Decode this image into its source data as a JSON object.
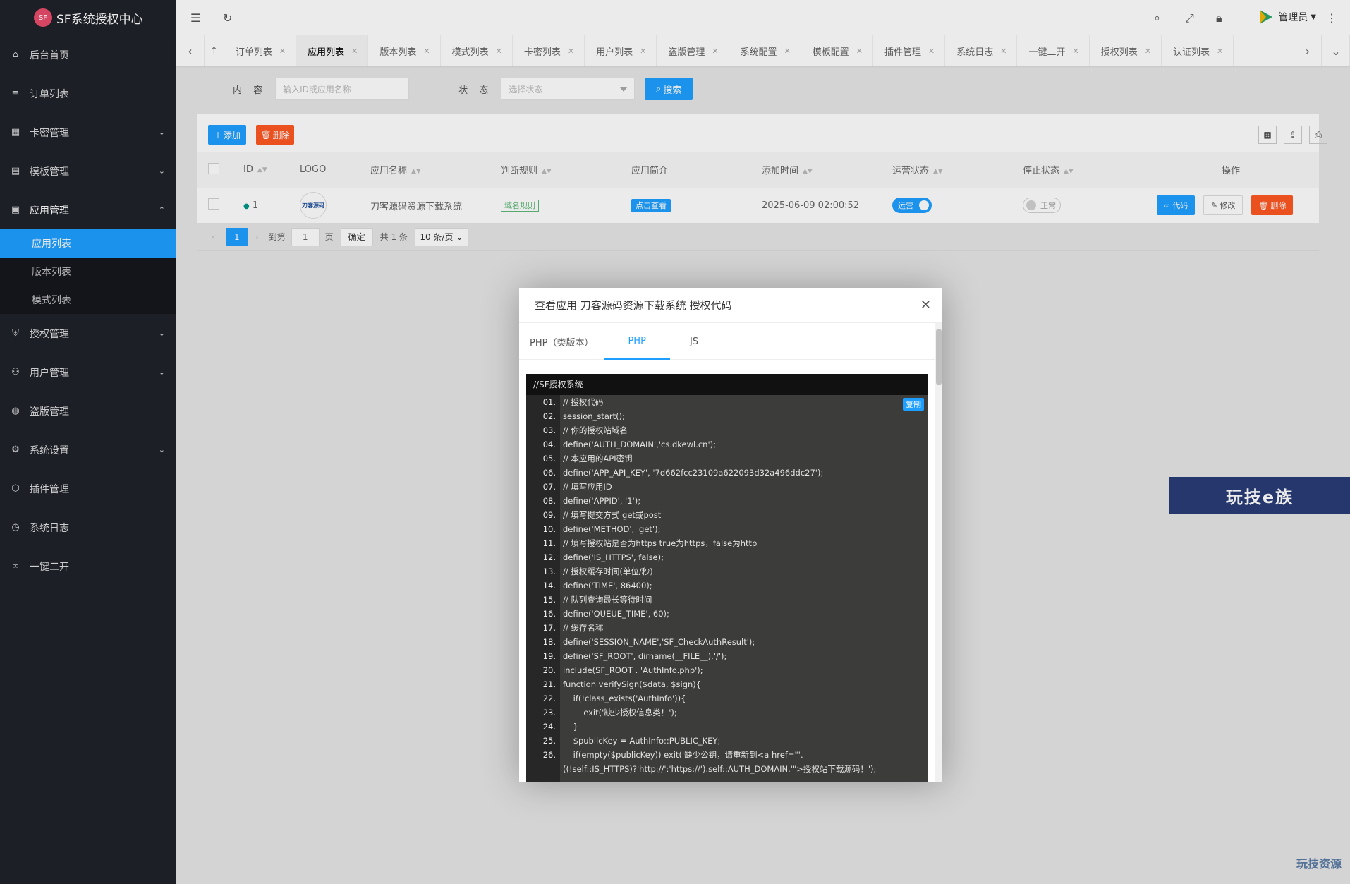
{
  "app": {
    "title": "SF系统授权中心",
    "logo_text": "SF"
  },
  "sidebar": {
    "items": [
      {
        "label": "后台首页",
        "icon": "home-icon"
      },
      {
        "label": "订单列表",
        "icon": "list-icon"
      },
      {
        "label": "卡密管理",
        "icon": "grid-icon"
      },
      {
        "label": "模板管理",
        "icon": "template-icon"
      },
      {
        "label": "应用管理",
        "icon": "apps-icon"
      },
      {
        "label": "授权管理",
        "icon": "shield-icon"
      },
      {
        "label": "用户管理",
        "icon": "user-icon"
      },
      {
        "label": "盗版管理",
        "icon": "globe-icon"
      },
      {
        "label": "系统设置",
        "icon": "gear-icon"
      },
      {
        "label": "插件管理",
        "icon": "plugin-icon"
      },
      {
        "label": "系统日志",
        "icon": "clock-icon"
      },
      {
        "label": "一键二开",
        "icon": "link-icon"
      }
    ],
    "sub_items": [
      "应用列表",
      "版本列表",
      "模式列表"
    ]
  },
  "header": {
    "user_label": "管理员"
  },
  "tabs": [
    "订单列表",
    "应用列表",
    "版本列表",
    "模式列表",
    "卡密列表",
    "用户列表",
    "盗版管理",
    "系统配置",
    "模板配置",
    "插件管理",
    "系统日志",
    "一键二开",
    "授权列表",
    "认证列表"
  ],
  "search": {
    "content_label": "内 容",
    "content_placeholder": "输入ID或应用名称",
    "status_label": "状 态",
    "status_placeholder": "选择状态",
    "search_button": "搜索"
  },
  "toolbar": {
    "add_label": "添加",
    "delete_label": "删除"
  },
  "table": {
    "headers": [
      "ID",
      "LOGO",
      "应用名称",
      "判断规则",
      "应用简介",
      "添加时间",
      "运营状态",
      "停止状态",
      "操作"
    ],
    "row": {
      "id": "1",
      "logo_text": "刀客源码",
      "name": "刀客源码资源下载系统",
      "rule": "域名规则",
      "intro": "点击查看",
      "added": "2025-06-09 02:00:52",
      "run_status": "运营",
      "stop_status": "正常",
      "code_btn": "代码",
      "edit_btn": "修改",
      "delete_btn": "删除"
    }
  },
  "pager": {
    "current": "1",
    "goto_label": "到第",
    "goto_value": "1",
    "page_label": "页",
    "confirm": "确定",
    "total": "共 1 条",
    "per_page": "10 条/页"
  },
  "dialog": {
    "title": "查看应用 刀客源码资源下载系统 授权代码",
    "tabs": [
      "PHP（类版本）",
      "PHP",
      "JS"
    ],
    "code_header": "//SF授权系统",
    "copy_label": "复制",
    "lines": [
      {
        "n": "01.",
        "t": "// 授权代码"
      },
      {
        "n": "02.",
        "t": "session_start();"
      },
      {
        "n": "03.",
        "t": "// 你的授权站域名"
      },
      {
        "n": "04.",
        "t": "define('AUTH_DOMAIN','cs.dkewl.cn');"
      },
      {
        "n": "05.",
        "t": "// 本应用的API密钥"
      },
      {
        "n": "06.",
        "t": "define('APP_API_KEY', '7d662fcc23109a622093d32a496ddc27');"
      },
      {
        "n": "07.",
        "t": "// 填写应用ID"
      },
      {
        "n": "08.",
        "t": "define('APPID', '1');"
      },
      {
        "n": "09.",
        "t": "// 填写提交方式 get或post"
      },
      {
        "n": "10.",
        "t": "define('METHOD', 'get');"
      },
      {
        "n": "11.",
        "t": "// 填写授权站是否为https true为https，false为http"
      },
      {
        "n": "12.",
        "t": "define('IS_HTTPS', false);"
      },
      {
        "n": "13.",
        "t": "// 授权缓存时间(单位/秒)"
      },
      {
        "n": "14.",
        "t": "define('TIME', 86400);"
      },
      {
        "n": "15.",
        "t": "// 队列查询最长等待时间"
      },
      {
        "n": "16.",
        "t": "define('QUEUE_TIME', 60);"
      },
      {
        "n": "17.",
        "t": "// 缓存名称"
      },
      {
        "n": "18.",
        "t": "define('SESSION_NAME','SF_CheckAuthResult');"
      },
      {
        "n": "19.",
        "t": "define('SF_ROOT', dirname(__FILE__).'/');"
      },
      {
        "n": "20.",
        "t": "include(SF_ROOT . 'AuthInfo.php');"
      },
      {
        "n": "21.",
        "t": "function verifySign($data, $sign){"
      },
      {
        "n": "22.",
        "t": "    if(!class_exists('AuthInfo')){"
      },
      {
        "n": "23.",
        "t": "        exit('缺少授权信息类！');"
      },
      {
        "n": "24.",
        "t": "    }"
      },
      {
        "n": "25.",
        "t": "    $publicKey = AuthInfo::PUBLIC_KEY;"
      },
      {
        "n": "26.",
        "t": "    if(empty($publicKey)) exit('缺少公钥，请重新到<a href=\"'."
      },
      {
        "n": "",
        "t": "((!self::IS_HTTPS)?'http://':'https://').self::AUTH_DOMAIN.'\">授权站下载源码！');"
      }
    ]
  },
  "promo": {
    "text": "玩技e族"
  },
  "watermark": {
    "text": "玩技资源"
  }
}
